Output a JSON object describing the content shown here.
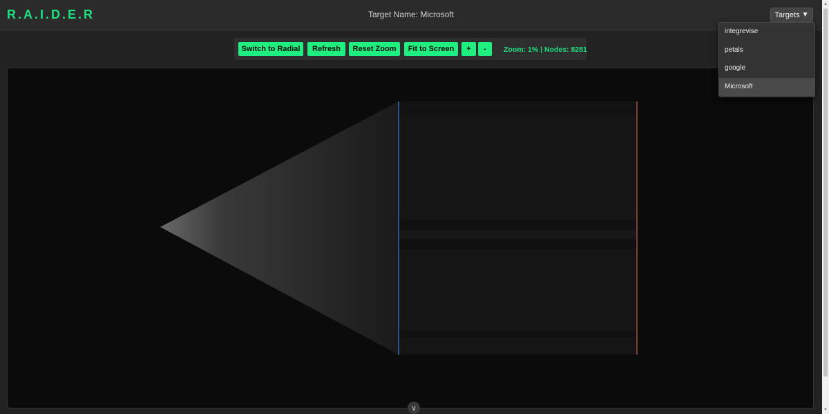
{
  "app": {
    "logo": "R.A.I.D.E.R",
    "target_title": "Target Name: Microsoft"
  },
  "targets_menu": {
    "button_label": "Targets",
    "caret": "▼",
    "items": [
      {
        "label": "integrevise",
        "selected": false
      },
      {
        "label": "petals",
        "selected": false
      },
      {
        "label": "google",
        "selected": false
      },
      {
        "label": "Microsoft",
        "selected": true
      }
    ]
  },
  "toolbar": {
    "switch_label": "Switch to Radial",
    "refresh_label": "Refresh",
    "reset_zoom_label": "Reset Zoom",
    "fit_label": "Fit to Screen",
    "zoom_in_label": "+",
    "zoom_out_label": "-",
    "status": "Zoom: 1% | Nodes: 8281"
  },
  "collapse_icon": "chevron-down-icon",
  "colors": {
    "accent": "#1fef7f",
    "left_edge_line": "#3a7bd5",
    "right_edge_line": "#c0604a",
    "canvas_bg": "#0b0b0b"
  }
}
